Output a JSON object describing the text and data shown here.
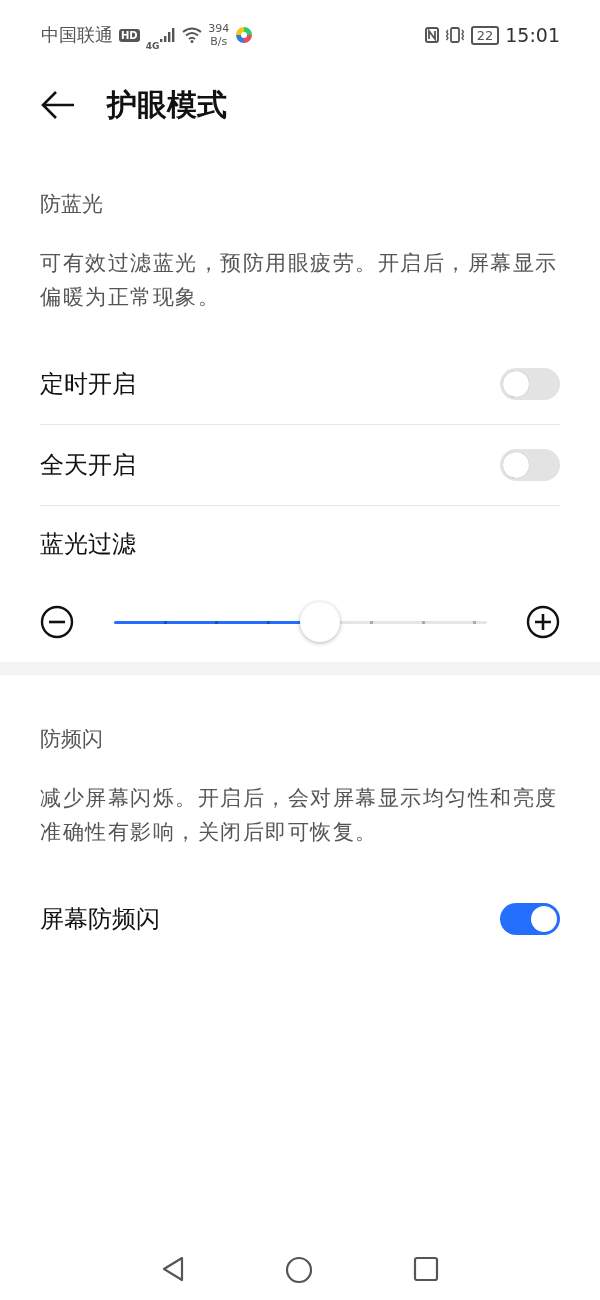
{
  "status_bar": {
    "carrier": "中国联通",
    "hd_badge": "HD",
    "network": "4G",
    "speed_value": "394",
    "speed_unit": "B/s",
    "battery": "22",
    "time": "15:01"
  },
  "header": {
    "title": "护眼模式"
  },
  "sections": [
    {
      "title": "防蓝光",
      "description": "可有效过滤蓝光，预防用眼疲劳。开启后，屏幕显示偏暖为正常现象。",
      "items": [
        {
          "kind": "switch",
          "label": "定时开启",
          "on": false
        },
        {
          "kind": "switch",
          "label": "全天开启",
          "on": false
        },
        {
          "kind": "slider",
          "label": "蓝光过滤",
          "level": 0.5
        }
      ]
    },
    {
      "title": "防频闪",
      "description": "减少屏幕闪烁。开启后，会对屏幕显示均匀性和亮度准确性有影响，关闭后即可恢复。",
      "items": [
        {
          "kind": "switch",
          "label": "屏幕防频闪",
          "on": true
        }
      ]
    }
  ]
}
